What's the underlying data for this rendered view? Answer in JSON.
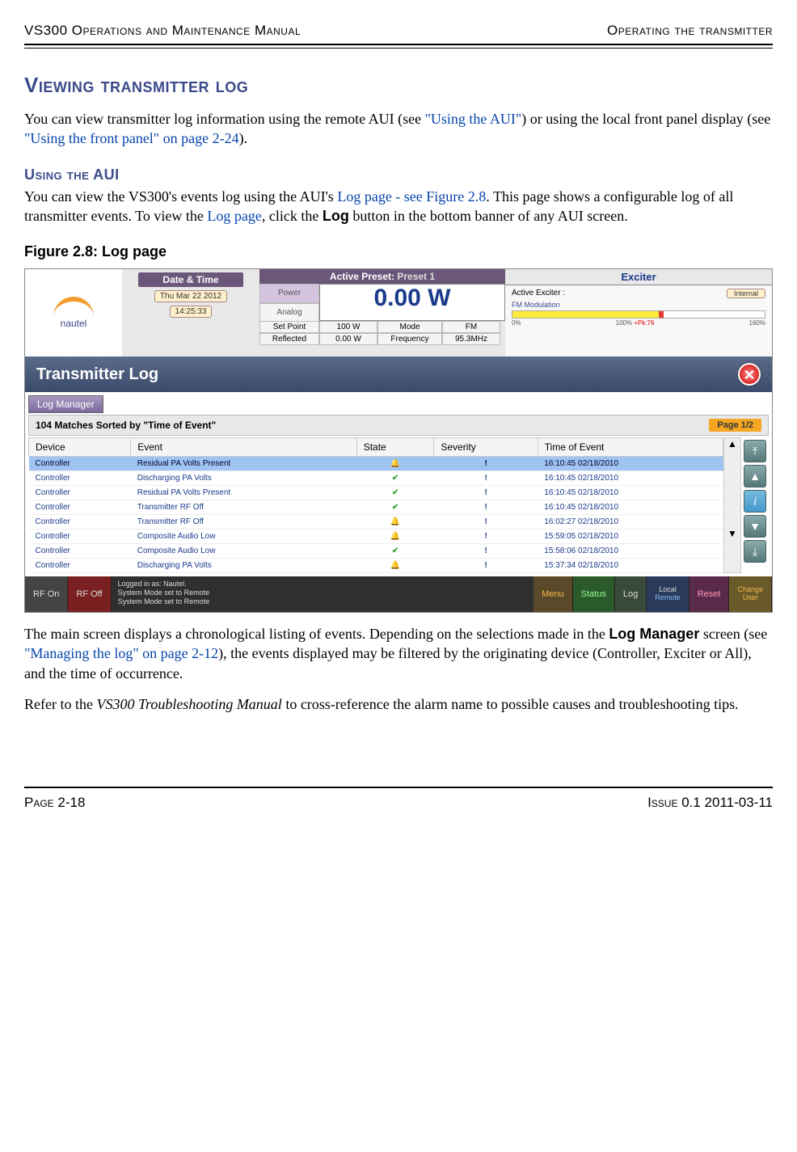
{
  "header": {
    "left": "VS300 Operations and Maintenance Manual",
    "right": "Operating the transmitter"
  },
  "h1": "Viewing transmitter log",
  "p1a": "You can view transmitter log information using the remote AUI (see ",
  "p1link1": "\"Using the AUI\"",
  "p1b": ") or using the local front panel display (see ",
  "p1link2": "\"Using the front panel\" on page 2-24",
  "p1c": ").",
  "h2": "Using the AUI",
  "p2a": "You can view the VS300's events log using the AUI's ",
  "p2link1": "Log page - see Figure 2.8",
  "p2b": ". This page shows a configurable log of all transmitter events. To view the ",
  "p2link2": "Log page",
  "p2c": ", click the ",
  "p2bold": "Log",
  "p2d": " button in the bottom banner of any AUI screen.",
  "figcap": "Figure 2.8: Log page",
  "ss": {
    "logo": "nautel",
    "dt_hdr": "Date & Time",
    "date": "Thu Mar 22 2012",
    "time": "14:25:33",
    "preset_label": "Active Preset:",
    "preset_val": "Preset 1",
    "pw_lbl1": "Power",
    "pw_lbl2": "Analog",
    "pw_val": "0.00 W",
    "sp_lbl": "Set Point",
    "sp_val": "100 W",
    "mode_lbl": "Mode",
    "mode_val": "FM",
    "ref_lbl": "Reflected",
    "ref_val": "0.00 W",
    "freq_lbl": "Frequency",
    "freq_val": "95.3MHz",
    "ex_hdr": "Exciter",
    "ex_active": "Active Exciter :",
    "ex_badge": "Internal",
    "ex_mod": "FM Modulation",
    "ex_0": "0%",
    "ex_100": "100%",
    "ex_pk": "+Pk:76",
    "ex_160": "160%",
    "tl_title": "Transmitter Log",
    "log_mgr": "Log Manager",
    "matches": "104 Matches Sorted by \"Time of Event\"",
    "page_badge": "Page 1/2",
    "cols": {
      "device": "Device",
      "event": "Event",
      "state": "State",
      "severity": "Severity",
      "time": "Time of Event"
    },
    "rows": [
      {
        "device": "Controller",
        "event": "Residual PA Volts Present",
        "state": "alarm",
        "time": "16:10:45 02/18/2010",
        "sel": true
      },
      {
        "device": "Controller",
        "event": "Discharging PA Volts",
        "state": "ok",
        "time": "16:10:45 02/18/2010"
      },
      {
        "device": "Controller",
        "event": "Residual PA Volts Present",
        "state": "ok",
        "time": "16:10:45 02/18/2010"
      },
      {
        "device": "Controller",
        "event": "Transmitter RF Off",
        "state": "ok",
        "time": "16:10:45 02/18/2010"
      },
      {
        "device": "Controller",
        "event": "Transmitter RF Off",
        "state": "alarm",
        "time": "16:02:27 02/18/2010"
      },
      {
        "device": "Controller",
        "event": "Composite Audio Low",
        "state": "alarm",
        "time": "15:59:05 02/18/2010"
      },
      {
        "device": "Controller",
        "event": "Composite Audio Low",
        "state": "ok",
        "time": "15:58:06 02/18/2010"
      },
      {
        "device": "Controller",
        "event": "Discharging PA Volts",
        "state": "alarm",
        "time": "15:37:34 02/18/2010"
      }
    ],
    "footer": {
      "rfon": "RF On",
      "rfoff": "RF Off",
      "status1": "Logged in as:    Nautel.",
      "status2": "System Mode set to Remote",
      "status3": "System Mode set to Remote",
      "menu": "Menu",
      "stat": "Status",
      "log": "Log",
      "local": "Local",
      "remote": "Remote",
      "reset": "Reset",
      "change": "Change",
      "user": "User"
    }
  },
  "p3a": "The main screen displays a chronological listing of events. Depending on the selections made in the ",
  "p3bold": "Log Manager",
  "p3b": " screen (see ",
  "p3link": "\"Managing the log\" on page 2-12",
  "p3c": "), the events displayed may be filtered by the originating device (Controller, Exciter or All), and the time of occurrence.",
  "p4a": "Refer to the ",
  "p4it": "VS300 Troubleshooting Manual",
  "p4b": " to cross-reference the alarm name to possible causes and troubleshooting tips.",
  "footer": {
    "left": "Page 2-18",
    "right": "Issue 0.1  2011-03-11"
  }
}
